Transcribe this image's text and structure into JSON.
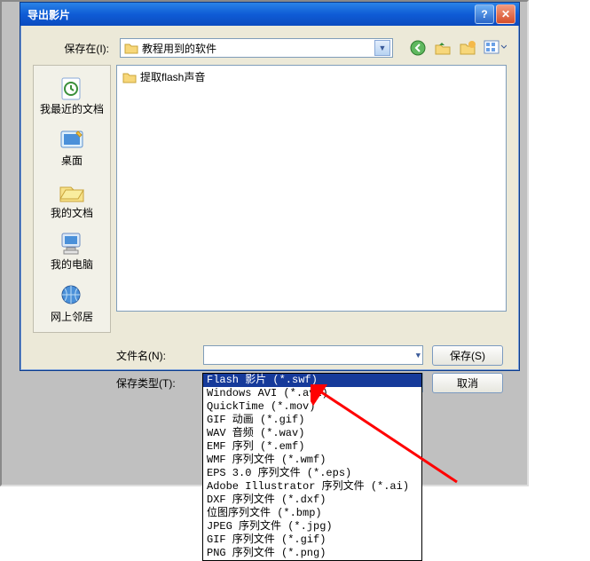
{
  "dialog": {
    "title": "导出影片",
    "saveInLabel": "保存在(I):",
    "saveInValue": "教程用到的软件",
    "filenameLabel": "文件名(N):",
    "filenameValue": "",
    "filetypeLabel": "保存类型(T):",
    "filetypeValue": "Flash 影片 (*.swf)",
    "saveButton": "保存(S)",
    "cancelButton": "取消"
  },
  "places": [
    {
      "label": "我最近的文档"
    },
    {
      "label": "桌面"
    },
    {
      "label": "我的文档"
    },
    {
      "label": "我的电脑"
    },
    {
      "label": "网上邻居"
    }
  ],
  "fileList": [
    {
      "name": "提取flash声音"
    }
  ],
  "filetypeOptions": [
    "Flash 影片 (*.swf)",
    "Windows AVI (*.avi)",
    "QuickTime (*.mov)",
    "GIF 动画 (*.gif)",
    "WAV 音频 (*.wav)",
    "EMF 序列 (*.emf)",
    "WMF 序列文件 (*.wmf)",
    "EPS 3.0 序列文件 (*.eps)",
    "Adobe Illustrator 序列文件 (*.ai)",
    "DXF 序列文件 (*.dxf)",
    "位图序列文件 (*.bmp)",
    "JPEG 序列文件 (*.jpg)",
    "GIF 序列文件 (*.gif)",
    "PNG 序列文件 (*.png)"
  ],
  "selectedOptionIndex": 0
}
